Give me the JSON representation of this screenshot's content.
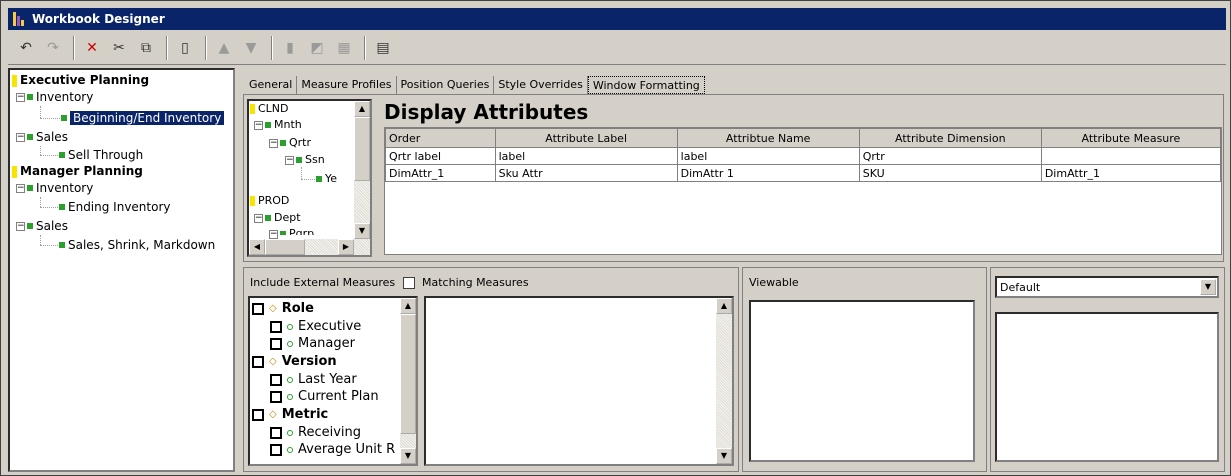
{
  "window": {
    "title": "Workbook Designer"
  },
  "toolbar": {
    "buttons": [
      {
        "icon": "undo-icon",
        "glyph": "↶",
        "enabled": true
      },
      {
        "icon": "redo-icon",
        "glyph": "↷",
        "enabled": false
      },
      {
        "icon": "delete-icon",
        "glyph": "✕",
        "enabled": true,
        "color": "#d00000"
      },
      {
        "icon": "cut-icon",
        "glyph": "✂",
        "enabled": true
      },
      {
        "icon": "copy-icon",
        "glyph": "⧉",
        "enabled": true
      },
      {
        "icon": "paste-icon",
        "glyph": "▯",
        "enabled": true
      },
      {
        "icon": "move-up-icon",
        "glyph": "▲",
        "enabled": false
      },
      {
        "icon": "move-down-icon",
        "glyph": "▼",
        "enabled": false
      },
      {
        "icon": "measure-icon",
        "glyph": "▮",
        "enabled": false
      },
      {
        "icon": "position-icon",
        "glyph": "◩",
        "enabled": false
      },
      {
        "icon": "grid-icon",
        "glyph": "▦",
        "enabled": false
      },
      {
        "icon": "chart-icon",
        "glyph": "▤",
        "enabled": true
      }
    ]
  },
  "left_tree": {
    "executive_planning": "Executive Planning",
    "inventory": "Inventory",
    "beginning_end": "Beginning/End Inventory",
    "sales": "Sales",
    "sell_through": "Sell Through",
    "manager_planning": "Manager Planning",
    "inventory2": "Inventory",
    "ending_inventory": "Ending Inventory",
    "sales2": "Sales",
    "sales_shrink": "Sales, Shrink, Markdown"
  },
  "tabs": [
    "General",
    "Measure Profiles",
    "Position Queries",
    "Style Overrides",
    "Window Formatting"
  ],
  "dim_tree": {
    "clnd": "CLND",
    "mnth": "Mnth",
    "qrtr": "Qrtr",
    "ssn": "Ssn",
    "ye": "Ye",
    "prod": "PROD",
    "dept": "Dept",
    "pgrp": "Pgrp"
  },
  "display_attributes": {
    "title": "Display Attributes",
    "columns": [
      "Order",
      "Attribute Label",
      "Attribtue Name",
      "Attribute Dimension",
      "Attribute Measure"
    ],
    "rows": [
      [
        "Qrtr label",
        "label",
        "label",
        "Qrtr",
        ""
      ],
      [
        "DimAttr_1",
        "Sku Attr",
        "DimAttr 1",
        "SKU",
        "DimAttr_1"
      ]
    ]
  },
  "lower": {
    "include_external": "Include External Measures",
    "matching": "Matching Measures",
    "viewable": "Viewable",
    "profile_select": "Default",
    "measures": {
      "role": "Role",
      "executive": "Executive",
      "manager": "Manager",
      "version": "Version",
      "last_year": "Last Year",
      "current_plan": "Current Plan",
      "metric": "Metric",
      "receiving": "Receiving",
      "avg_unit": "Average Unit R"
    }
  }
}
